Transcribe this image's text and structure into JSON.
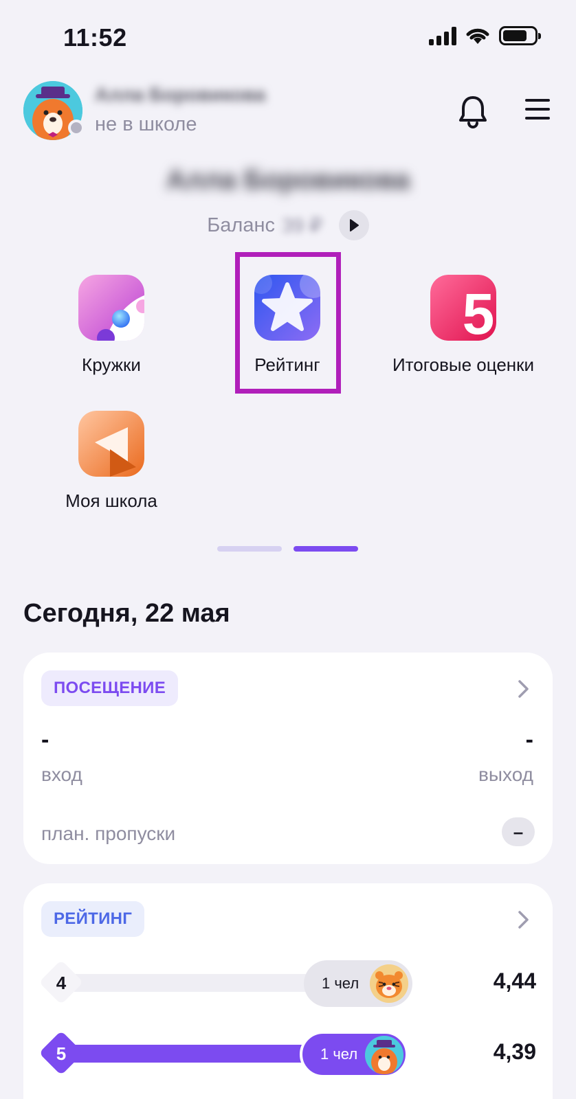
{
  "status_bar": {
    "time": "11:52",
    "icons": [
      "signal-icon",
      "wifi-icon",
      "battery-icon"
    ]
  },
  "header": {
    "user_name": "Алла Боровикова",
    "user_status": "не в школе",
    "icons": [
      "avatar-bear",
      "bell-icon",
      "menu-icon"
    ]
  },
  "student": {
    "name": "Алла Боровикова",
    "balance_label": "Баланс",
    "balance_value": "39 ₽"
  },
  "apps": [
    {
      "label": "Кружки",
      "icon": "clubs-icon"
    },
    {
      "label": "Рейтинг",
      "icon": "star-icon"
    },
    {
      "label": "Итоговые оценки",
      "icon": "grade-five-icon"
    },
    {
      "label": "Моя школа",
      "icon": "school-icon"
    }
  ],
  "colors": {
    "accent": "#7c4bf0",
    "highlight": "#b01fba",
    "chip_attendance_bg": "#eeebfd",
    "chip_rating_bg": "#eaeefc",
    "pager_active": "#7c4bf0",
    "pager_inactive": "#d6d1f1"
  },
  "today": {
    "title": "Сегодня, 22 мая",
    "attendance": {
      "chip": "ПОСЕЩЕНИЕ",
      "enter_value": "-",
      "enter_label": "вход",
      "exit_value": "-",
      "exit_label": "выход",
      "plan_label": "план. пропуски",
      "plan_value": "–"
    },
    "rating": {
      "chip": "РЕЙТИНГ",
      "rows": [
        {
          "rank": "4",
          "count": "1 чел",
          "score": "4,44",
          "avatar": "tiger-avatar"
        },
        {
          "rank": "5",
          "count": "1 чел",
          "score": "4,39",
          "avatar": "bear-avatar"
        }
      ]
    }
  }
}
